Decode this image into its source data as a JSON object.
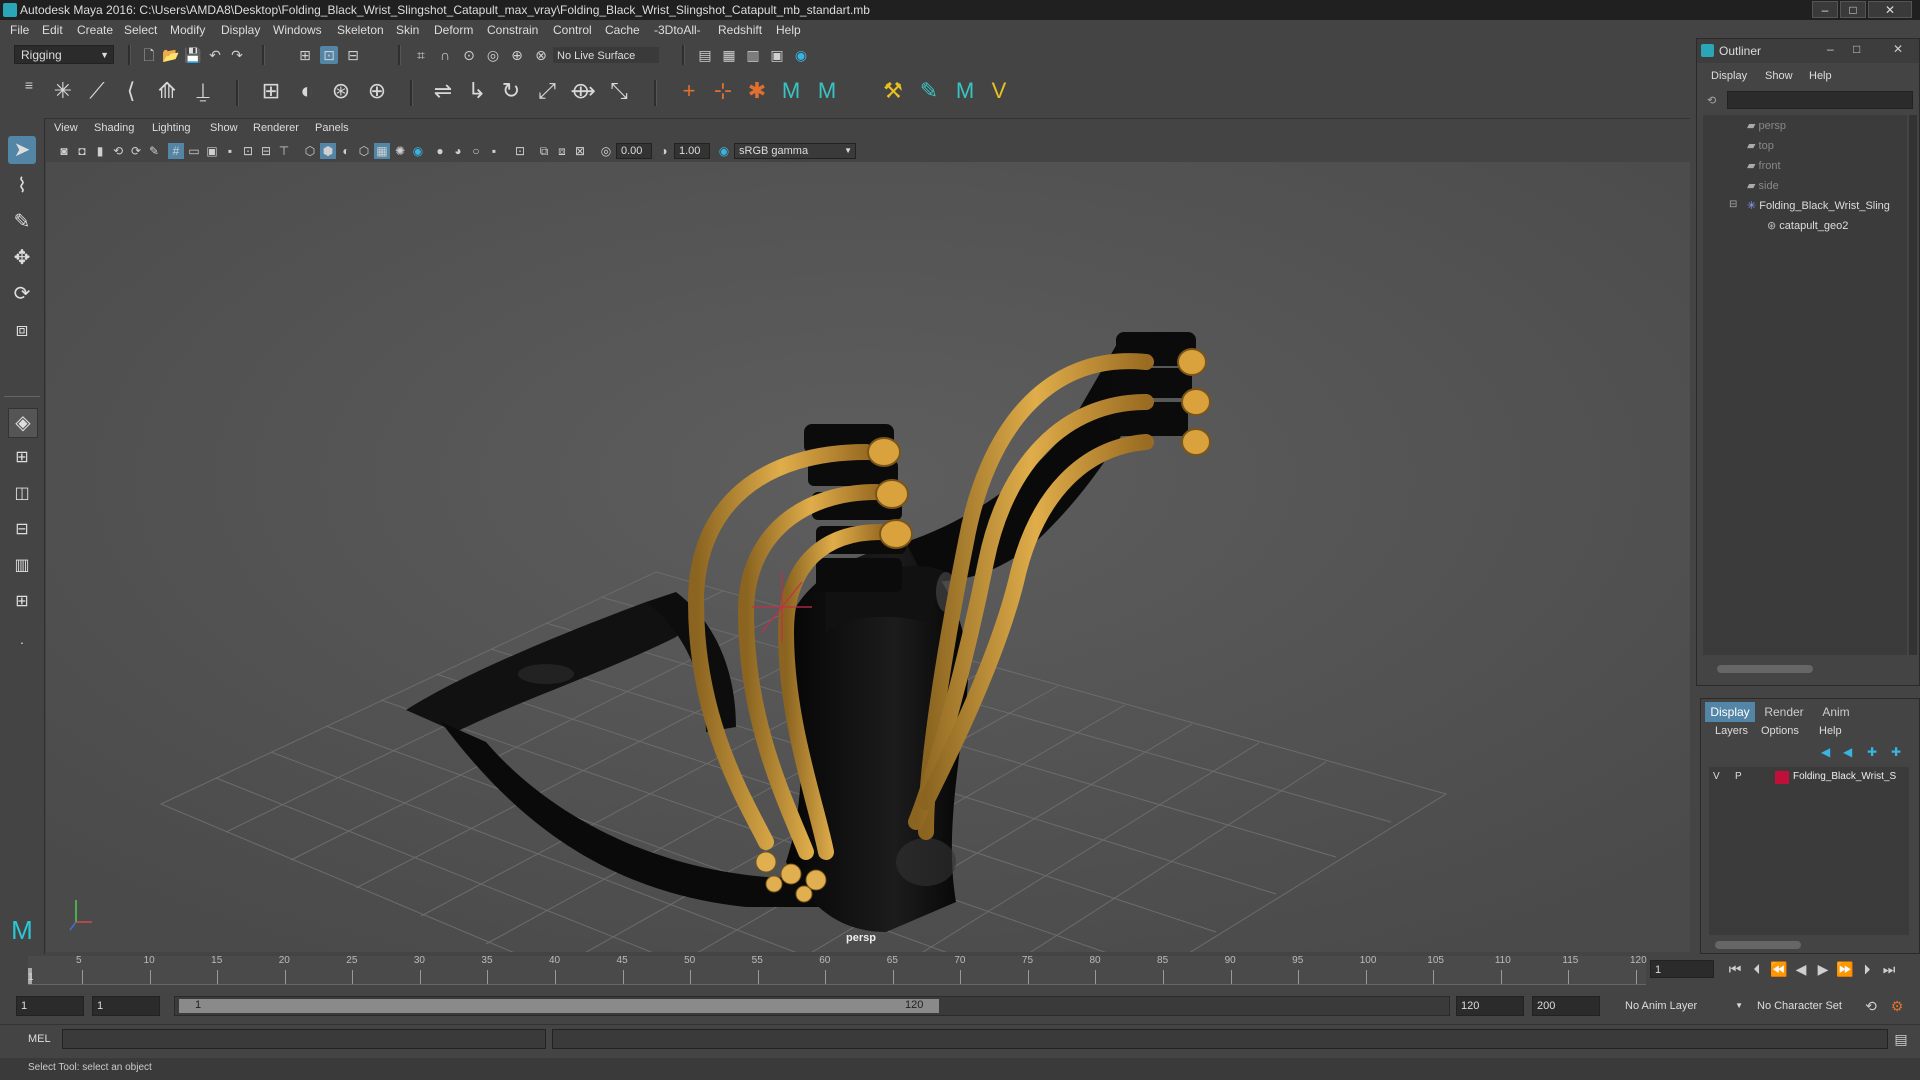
{
  "window": {
    "title": "Autodesk Maya 2016: C:\\Users\\AMDA8\\Desktop\\Folding_Black_Wrist_Slingshot_Catapult_max_vray\\Folding_Black_Wrist_Slingshot_Catapult_mb_standart.mb",
    "minimize": "–",
    "maximize": "□",
    "close": "✕"
  },
  "menubar": [
    "File",
    "Edit",
    "Create",
    "Select",
    "Modify",
    "Display",
    "Windows",
    "Skeleton",
    "Skin",
    "Deform",
    "Constrain",
    "Control",
    "Cache",
    "-3DtoAll-",
    "Redshift",
    "Help"
  ],
  "statusline": {
    "mode": "Rigging",
    "live_surface": "No Live Surface"
  },
  "panel": {
    "menus": [
      "View",
      "Shading",
      "Lighting",
      "Show",
      "Renderer",
      "Panels"
    ],
    "exposure": "0.00",
    "gamma": "1.00",
    "color_space": "sRGB gamma",
    "camera_label": "persp"
  },
  "outliner": {
    "title": "Outliner",
    "menus": [
      "Display",
      "Show",
      "Help"
    ],
    "items": [
      {
        "label": "persp",
        "dim": true
      },
      {
        "label": "top",
        "dim": true
      },
      {
        "label": "front",
        "dim": true
      },
      {
        "label": "side",
        "dim": true
      },
      {
        "label": "Folding_Black_Wrist_Sling",
        "dim": false
      },
      {
        "label": "catapult_geo2",
        "dim": false
      }
    ]
  },
  "layer_editor": {
    "tabs": [
      "Display",
      "Render",
      "Anim"
    ],
    "menus": [
      "Layers",
      "Options",
      "Help"
    ],
    "layer": {
      "v": "V",
      "p": "P",
      "name": "Folding_Black_Wrist_S",
      "color": "#c0103a"
    }
  },
  "timeline": {
    "ticks": [
      "5",
      "10",
      "15",
      "20",
      "25",
      "30",
      "35",
      "40",
      "45",
      "50",
      "55",
      "60",
      "65",
      "70",
      "75",
      "80",
      "85",
      "90",
      "95",
      "100",
      "105",
      "110",
      "115",
      "120"
    ],
    "first_tick": "1",
    "current_frame": "1"
  },
  "range": {
    "start": "1",
    "inner_start": "1",
    "slider_start": "1",
    "slider_end": "120",
    "end": "120",
    "max": "200",
    "anim_layer": "No Anim Layer",
    "character_set": "No Character Set"
  },
  "cmdline": {
    "lang": "MEL"
  },
  "help_line": "Select Tool: select an object",
  "colors": {
    "accent": "#5285a6",
    "rope": "#c9962e",
    "frame": "#0a0a0a"
  }
}
